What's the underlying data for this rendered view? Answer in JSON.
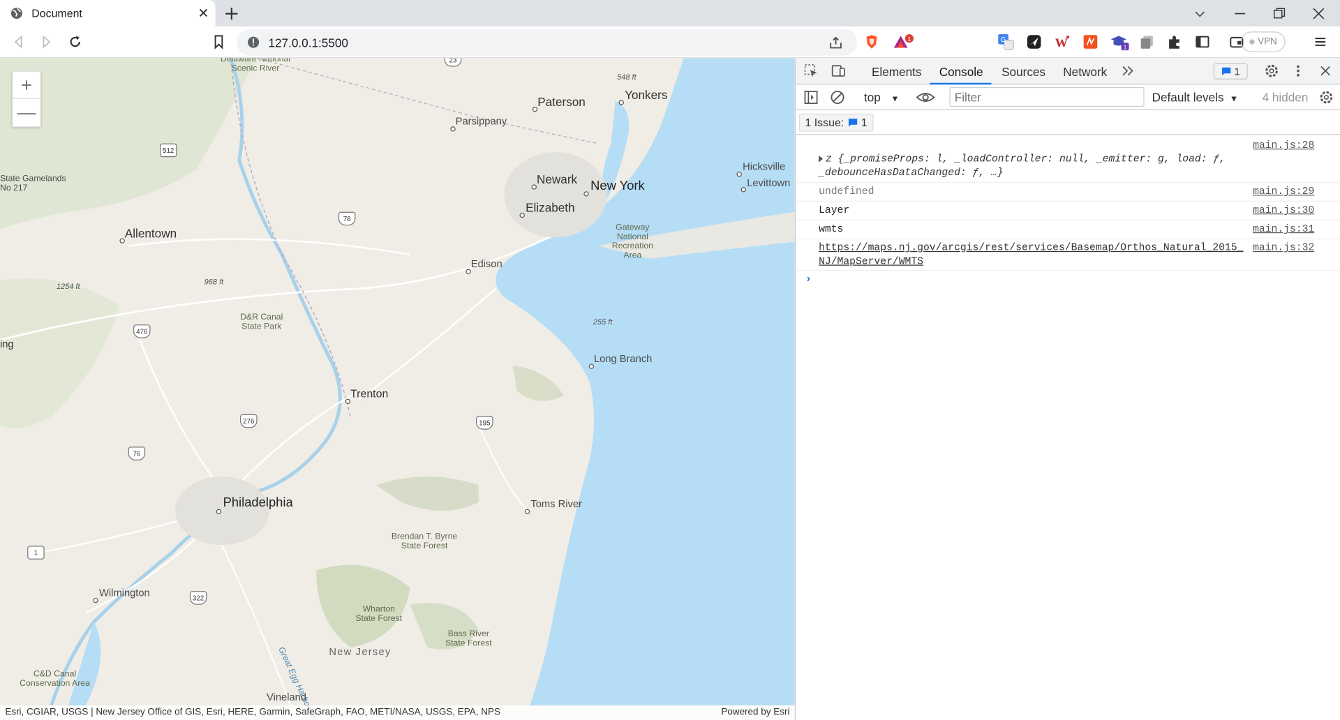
{
  "browser": {
    "tab_title": "Document",
    "url": "127.0.0.1:5500",
    "vpn_label": "VPN",
    "brave_badge": "1",
    "ext_badge": "1"
  },
  "map": {
    "zoom_in_label": "+",
    "zoom_out_label": "—",
    "attribution": "Esri, CGIAR, USGS | New Jersey Office of GIS, Esri, HERE, Garmin, SafeGraph, FAO, METI/NASA, USGS, EPA, NPS",
    "powered_by": "Powered by Esri",
    "labels": {
      "delaware": "Delaware National\nScenic River",
      "paterson": "Paterson",
      "yonkers": "Yonkers",
      "parsippany": "Parsippany",
      "newark": "Newark",
      "new_york": "New York",
      "elizabeth": "Elizabeth",
      "hicksville": "Hicksville",
      "levittown": "Levittown",
      "gateway": "Gateway\nNational\nRecreation\nArea",
      "allentown": "Allentown",
      "state_gamelands": "State Gamelands\nNo 217",
      "edison": "Edison",
      "dr_canal": "D&R Canal\nState Park",
      "long_branch": "Long Branch",
      "trenton": "Trenton",
      "philadelphia": "Philadelphia",
      "toms_river": "Toms River",
      "brendan": "Brendan T. Byrne\nState Forest",
      "wilmington": "Wilmington",
      "wharton": "Wharton\nState Forest",
      "bass_river": "Bass River\nState Forest",
      "new_jersey": "New Jersey",
      "cd_canal": "C&D Canal\nConservation Area",
      "vineland": "Vineland",
      "great_egg": "Great Egg Harbor River",
      "ing": "ing",
      "elev_548": "548 ft",
      "elev_1254": "1254 ft",
      "elev_968": "968 ft",
      "elev_255": "255 ft"
    },
    "shields": {
      "s23": "23",
      "s512": "512",
      "s78": "78",
      "s476": "476",
      "s276": "276",
      "s195": "195",
      "s76": "76",
      "s1": "1",
      "s322": "322"
    }
  },
  "devtools": {
    "tabs": [
      "Elements",
      "Console",
      "Sources",
      "Network"
    ],
    "issues_badge_count": "1",
    "context": "top",
    "filter_placeholder": "Filter",
    "levels": "Default levels",
    "hidden": "4 hidden",
    "issues_label": "1 Issue:",
    "issues_count": "1",
    "console_rows": [
      {
        "source": "main.js:28",
        "text": "z {_promiseProps: l, _loadController: null, _emitter: g, load: ƒ, _debounceHasDataChanged: ƒ, …}"
      },
      {
        "source": "main.js:29",
        "text": "undefined"
      },
      {
        "source": "main.js:30",
        "text": "Layer"
      },
      {
        "source": "main.js:31",
        "text": "wmts"
      },
      {
        "source": "main.js:32",
        "text": "https://maps.nj.gov/arcgis/rest/services/Basemap/Orthos_Natural_2015_NJ/MapServer/WMTS"
      }
    ],
    "prompt": "›"
  }
}
